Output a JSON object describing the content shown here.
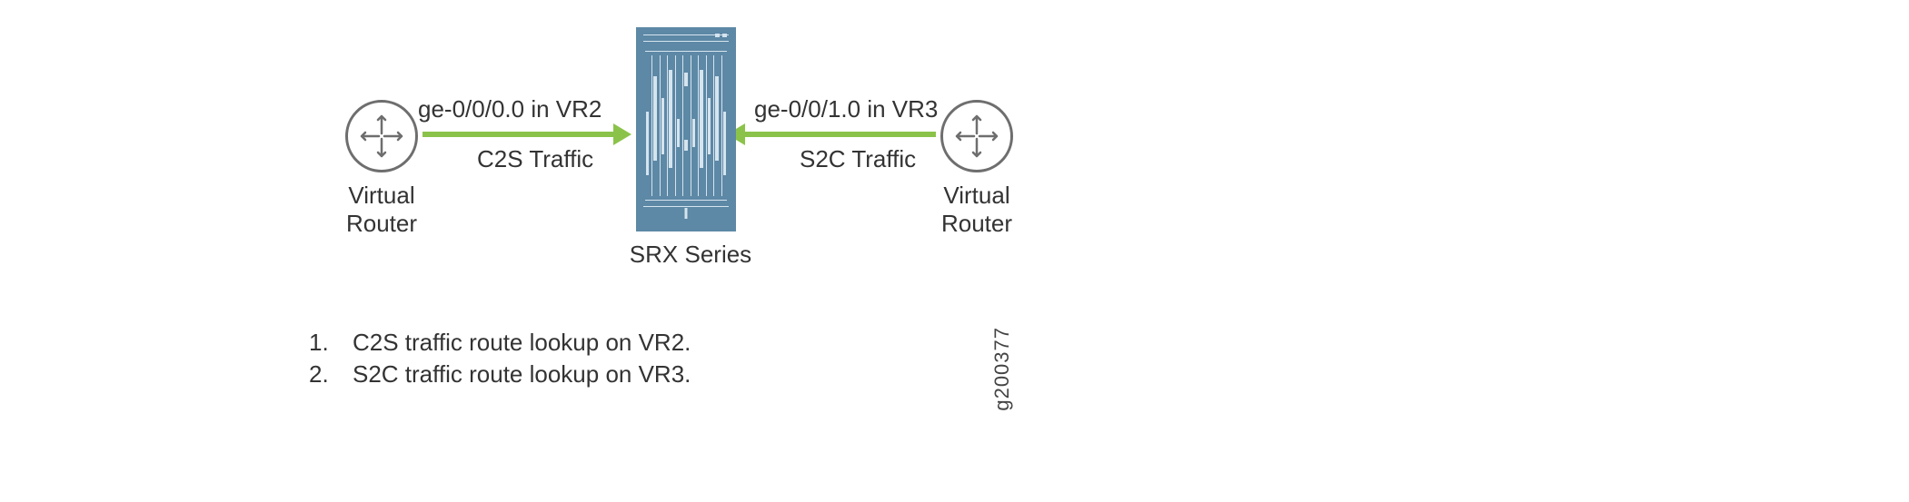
{
  "left_router": {
    "label": "Virtual\nRouter"
  },
  "right_router": {
    "label": "Virtual\nRouter"
  },
  "left_arrow": {
    "top_label": "ge-0/0/0.0 in VR2",
    "bottom_label": "C2S Traffic"
  },
  "right_arrow": {
    "top_label": "ge-0/0/1.0 in VR3",
    "bottom_label": "S2C Traffic"
  },
  "center_device": {
    "label": "SRX Series"
  },
  "notes": [
    {
      "num": "1.",
      "text": "C2S traffic route lookup on VR2."
    },
    {
      "num": "2.",
      "text": "S2C traffic route lookup on VR3."
    }
  ],
  "figure_id": "g200377"
}
